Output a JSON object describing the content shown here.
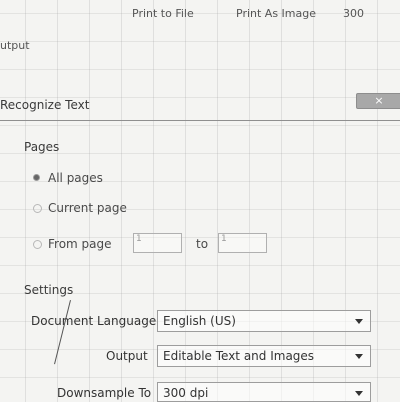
{
  "background_window": {
    "top_labels": [
      "Print to File",
      "Print As Image",
      "300"
    ],
    "output_label": "utput"
  },
  "dialog": {
    "title": "Recognize Text",
    "close_glyph": "×",
    "pages": {
      "heading": "Pages",
      "options": [
        "All pages",
        "Current page",
        "From page"
      ],
      "selected": "All pages",
      "from_value": "1",
      "to_label": "to",
      "to_value": "1"
    },
    "settings": {
      "heading": "Settings",
      "document_language": {
        "label": "Document Language",
        "value": "English (US)"
      },
      "output": {
        "label": "Output",
        "value": "Editable Text and Images"
      },
      "downsample": {
        "label": "Downsample To",
        "value": "300 dpi"
      }
    }
  },
  "colors": {
    "background": "#f4f4f2",
    "close_button": "#a8a8a8",
    "divider": "#8f8f8f"
  },
  "icons": {
    "close": "close-icon",
    "dropdown": "chevron-down-icon",
    "radio_selected": "radio-selected-icon"
  }
}
